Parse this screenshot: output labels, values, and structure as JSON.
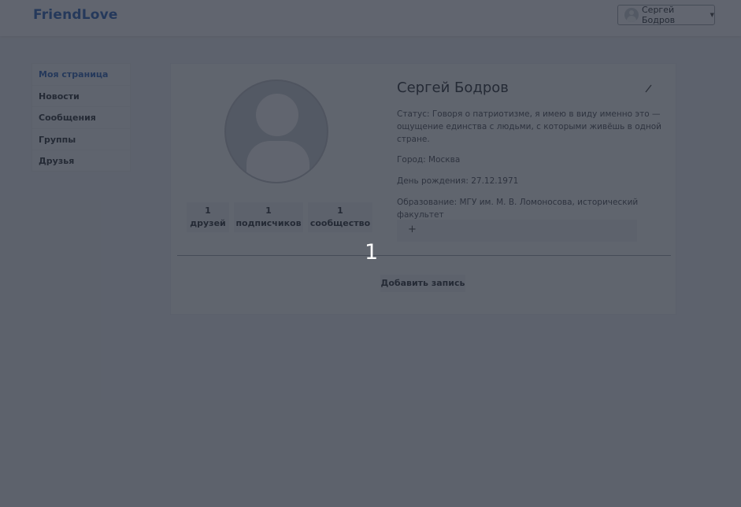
{
  "navbar": {
    "brand": "FriendLove",
    "user_name": "Сергей Бодров"
  },
  "sidebar": {
    "items": [
      {
        "label": "Моя страница",
        "active": true
      },
      {
        "label": "Новости"
      },
      {
        "label": "Сообщения"
      },
      {
        "label": "Группы"
      },
      {
        "label": "Друзья"
      }
    ]
  },
  "profile": {
    "name": "Сергей Бодров",
    "status": "Статус: Говоря о патриотизме, я имею в виду именно это — ощущение единства с людьми, с которыми живёшь в одной стране.",
    "city": "Город: Москва",
    "birthday": "День рождения: 27.12.1971",
    "education": "Образование: МГУ им. М. В. Ломоносова, исторический факультет",
    "add_field_label": "+"
  },
  "stats": [
    {
      "count": "1",
      "label": "друзей"
    },
    {
      "count": "1",
      "label": "подписчиков"
    },
    {
      "count": "1",
      "label": "сообщество"
    }
  ],
  "posts": {
    "add_post_label": "Добавить запись"
  },
  "overlay": {
    "number": "1"
  },
  "icons": {
    "user": "user-avatar-icon",
    "edit": "pencil-icon",
    "caret": "caret-down-icon"
  },
  "colors": {
    "brand": "#2d62b5",
    "overlay": "rgba(34,40,52,0.70)"
  }
}
